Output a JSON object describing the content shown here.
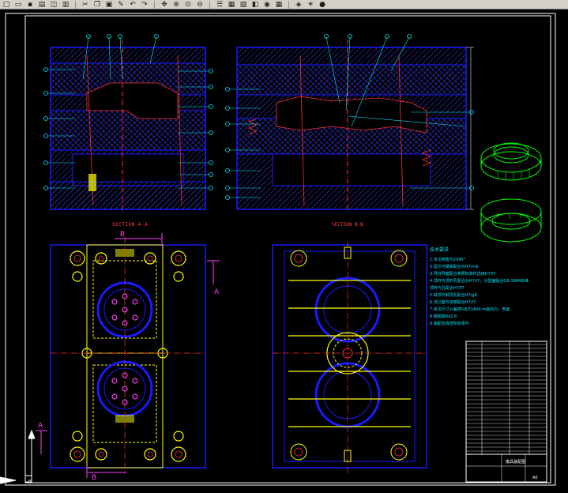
{
  "toolbar": {
    "icons": [
      "new-icon",
      "open-icon",
      "save-icon",
      "print-icon",
      "preview-icon",
      "plot-icon",
      "cut-icon",
      "copy-icon",
      "paste-icon",
      "match-icon",
      "undo-icon",
      "redo-icon",
      "pan-icon",
      "zoom-realtime-icon",
      "zoom-window-icon",
      "zoom-previous-icon",
      "properties-icon",
      "design-center-icon",
      "tool-palette-icon",
      "sheetset-icon",
      "markup-icon",
      "calculator-icon",
      "layer-icon",
      "light-icon",
      "color-icon"
    ]
  },
  "drawing": {
    "section_aa_label": "SECTION A-A",
    "section_bb_label": "SECTION B-B",
    "cut_marker_a": "A",
    "cut_marker_b": "B",
    "notes_title": "技术要求",
    "notes": [
      "1.未注倒角为2X45°",
      "2.型芯与模板配合为H7/m6",
      "3.导柱导套配合参照标准件选用H7/f7",
      "4.顶杆与顶杆孔配合为H7/f7，分型面贴合GB-1984标准",
      "  顶杆与孔配合H7/f7",
      "5.斜顶与斜顶孔配合H7/g6",
      "6.浇口套与定模配合H7/f7",
      "7.未注尺寸公差按GB/T1804-m级执行，表面",
      "8.粗糙度Ra1.6",
      "9.装配前清洗所有零件"
    ],
    "title_block_name": "模具装配图",
    "title_block_code": "A0"
  },
  "colors": {
    "background": "#000000",
    "plate_blue": "#1a1aff",
    "section_hatch": "#4040ff",
    "leader_cyan": "#00e5ff",
    "centerline_red": "#ff3030",
    "yellow": "#ffff00",
    "magenta": "#ff40ff",
    "green_part": "#00ff00",
    "white": "#ffffff"
  }
}
